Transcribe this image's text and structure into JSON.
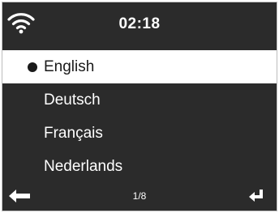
{
  "status_bar": {
    "time": "02:18",
    "icon": "wifi-icon"
  },
  "language_menu": {
    "items": [
      {
        "label": "English",
        "selected": true
      },
      {
        "label": "Deutsch",
        "selected": false
      },
      {
        "label": "Français",
        "selected": false
      },
      {
        "label": "Nederlands",
        "selected": false
      }
    ]
  },
  "footer": {
    "page_indicator": "1/8",
    "back_icon": "back-arrow-icon",
    "enter_icon": "enter-icon"
  },
  "colors": {
    "screen_bg": "#2b2b2b",
    "selected_bg": "#ffffff",
    "text": "#ffffff"
  }
}
